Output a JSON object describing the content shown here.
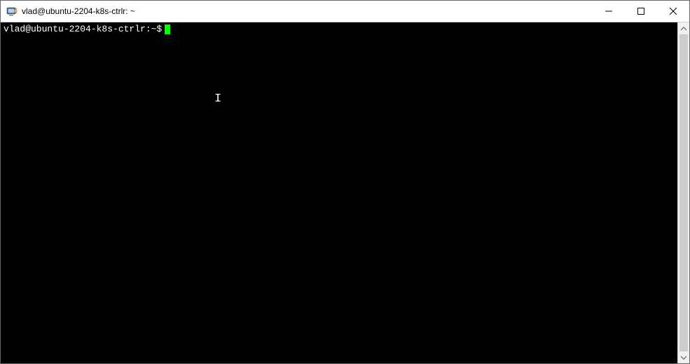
{
  "window": {
    "title": "vlad@ubuntu-2204-k8s-ctrlr: ~"
  },
  "terminal": {
    "prompt": "vlad@ubuntu-2204-k8s-ctrlr:~$",
    "cursor_color": "#00ff00",
    "background": "#000000",
    "foreground": "#ffffff"
  },
  "icons": {
    "minimize": "minimize",
    "maximize": "maximize",
    "close": "close",
    "scroll_up": "up",
    "scroll_down": "down",
    "app": "putty"
  }
}
